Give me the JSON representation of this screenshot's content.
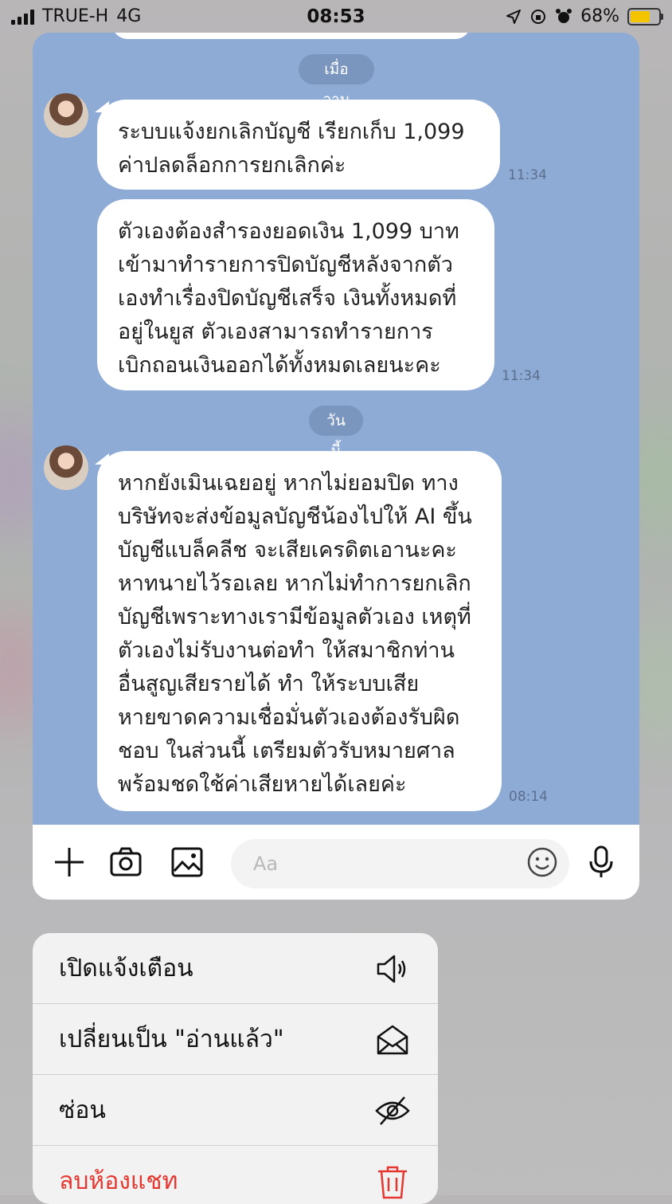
{
  "status_bar": {
    "carrier": "TRUE-H",
    "network": "4G",
    "time": "08:53",
    "battery": "68%",
    "battery_color": "#f5c400"
  },
  "chat": {
    "background_color": "#8eabd6",
    "date_separators": [
      "เมื่อวาน",
      "วันนี้"
    ],
    "messages": [
      {
        "lines": [
          "ระบบแจ้งยกเลิกบัญชี เรียกเก็บ 1,099",
          "ค่าปลดล็อกการยกเลิกค่ะ"
        ],
        "time": "11:34"
      },
      {
        "lines": [
          "ตัวเองต้องสำรองยอดเงิน 1,099 บาท",
          "เข้ามาทำรายการปิดบัญชีหลังจากตัว",
          "เองทำเรื่องปิดบัญชีเสร็จ  เงินทั้งหมดที่",
          "อยู่ในยูส  ตัวเองสามารถทำรายการ",
          "เบิกถอนเงินออกได้ทั้งหมดเลยนะคะ"
        ],
        "time": "11:34"
      },
      {
        "lines": [
          "หากยังเมินเฉยอยู่ หากไม่ยอมปิด ทาง",
          "บริษัทจะส่งข้อมูลบัญชีน้องไปให้ AI ขึ้น",
          "บัญชีแบล็คลีช จะเสียเครดิตเอานะคะ",
          "หาทนายไว้รอเลย หากไม่ทำการยกเลิก",
          "บัญชีเพราะทางเรามีข้อมูลตัวเอง เหตุที่",
          "ตัวเองไม่รับงานต่อทำ ให้สมาชิกท่าน",
          "อื่นสูญเสียรายได้ ทำ ให้ระบบเสีย",
          "หายขาดความเชื่อมั่นตัวเองต้องรับผิด",
          "ชอบ ในส่วนนี้ เตรียมตัวรับหมายศาล",
          "พร้อมชดใช้ค่าเสียหายได้เลยค่ะ"
        ],
        "time": "08:14"
      }
    ]
  },
  "input_bar": {
    "placeholder": "Aa",
    "icons": [
      "plus-icon",
      "camera-icon",
      "image-icon",
      "emoji-icon",
      "microphone-icon"
    ]
  },
  "context_menu": {
    "items": [
      {
        "label": "เปิดแจ้งเตือน",
        "icon": "speaker-icon"
      },
      {
        "label": "เปลี่ยนเป็น \"อ่านแล้ว\"",
        "icon": "open-envelope-icon"
      },
      {
        "label": "ซ่อน",
        "icon": "eye-slash-icon"
      },
      {
        "label": "ลบห้องแชท",
        "icon": "trash-icon",
        "color": "#e5372f"
      }
    ]
  }
}
